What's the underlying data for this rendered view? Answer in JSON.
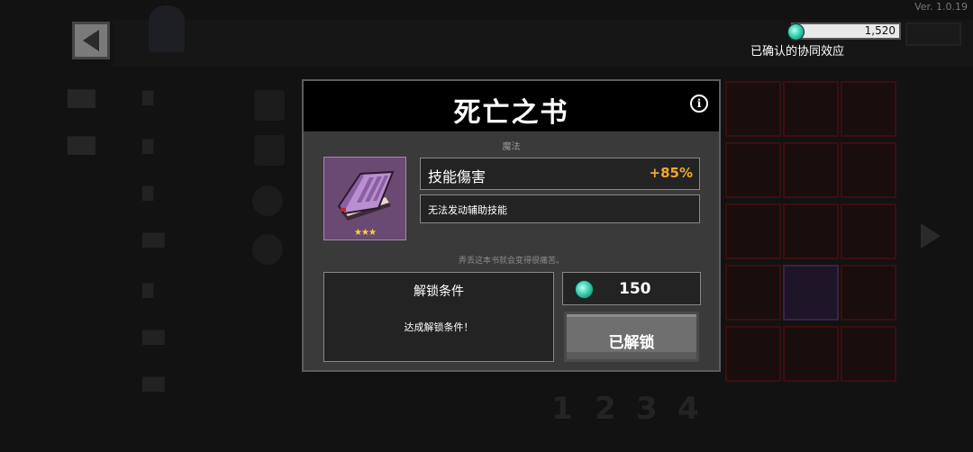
{
  "app": {
    "version": "Ver. 1.0.19",
    "gems": "1,520",
    "synergy_label": "已确认的协同效应"
  },
  "dialog": {
    "title": "死亡之书",
    "category": "魔法",
    "item_rarity_stars": "★★★",
    "stat": {
      "name": "技能傷害",
      "value": "+85%"
    },
    "description": "无法发动辅助技能",
    "flavor_text": "弄丢这本书就会变得很痛苦。",
    "unlock": {
      "title": "解锁条件",
      "condition": "达成解锁条件！"
    },
    "price": "150",
    "unlocked_button_label": "已解锁"
  },
  "background_pagination": [
    "1",
    "2",
    "3",
    "4"
  ],
  "colors": {
    "accent_value": "#f0a92a",
    "item_bg": "#6a4a73",
    "gem": "#3ad0b2"
  },
  "icons": {
    "back": "back-arrow-icon",
    "info": "info-icon",
    "gem": "gem-icon",
    "item": "purple-book-icon"
  }
}
